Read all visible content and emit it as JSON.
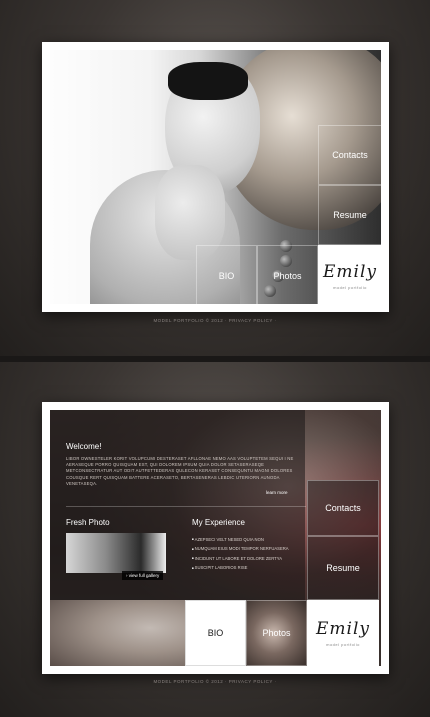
{
  "top": {
    "nav": {
      "contacts": "Contacts",
      "resume": "Resume",
      "bio": "BIO",
      "photos": "Photos"
    },
    "logo": {
      "name": "Emily",
      "tagline": "model portfolio"
    },
    "footer": "MODEL PORTFOLIO © 2012 · PRIVACY POLICY ·"
  },
  "bottom": {
    "welcome": {
      "title": "Welcome!",
      "text": "Libor ownesteler korit volupcumi desteraset afllonae nemo aas voluptetem sequi i ne aeraseque porro quisquam est, qui dolorem ipsum quia dolor setaseraseqe metconsectratur aut odit autfettederas qulecon keraset consequntu magni dolores cousque rert quisquam battere aceraseto, bertaseneras lebdic uteriorn aunoda venetaseqa.",
      "learn_more": "learn more"
    },
    "fresh_photo": {
      "title": "Fresh Photo",
      "gallery_link": "view full gallery"
    },
    "experience": {
      "title": "My Experience",
      "items": [
        "Azepseci velt nesed quia non",
        "Numquam eius modi tempor nerfuasera",
        "Incidunt ut labore et dolore zertya",
        "Suscipit laborios rise"
      ]
    },
    "nav": {
      "contacts": "Contacts",
      "resume": "Resume",
      "bio": "BIO",
      "photos": "Photos"
    },
    "logo": {
      "name": "Emily",
      "tagline": "model portfolio"
    },
    "footer": "MODEL PORTFOLIO © 2012 · PRIVACY POLICY ·"
  }
}
